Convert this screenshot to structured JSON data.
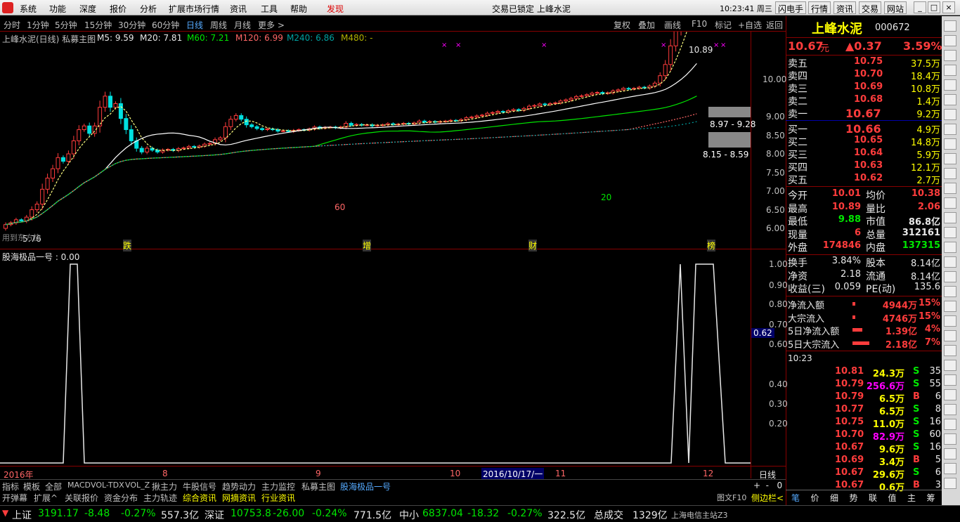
{
  "menu": {
    "items": [
      "系统",
      "功能",
      "深度",
      "报价",
      "分析",
      "扩展市场行情",
      "资讯",
      "工具",
      "帮助"
    ],
    "discover": "发现",
    "center": "交易已锁定  上峰水泥",
    "time": "10:23:41 周三",
    "buttons": [
      "闪电手",
      "行情",
      "资讯",
      "交易",
      "网站"
    ]
  },
  "period": {
    "tabs": [
      "分时",
      "1分钟",
      "5分钟",
      "15分钟",
      "30分钟",
      "60分钟",
      "日线",
      "周线",
      "月线",
      "更多 >"
    ],
    "right": [
      "复权",
      "叠加",
      "画线",
      "F10",
      "标记",
      "+自选",
      "返回"
    ]
  },
  "title": {
    "name": "上峰水泥(日线) 私募主图",
    "ma5": "M5: 9.59",
    "ma20": "M20: 7.81",
    "ma60": "M60: 7.21",
    "ma120": "M120: 6.99",
    "ma240": "M240: 6.86",
    "ma480": "M480: -"
  },
  "price_axis": [
    "10.00",
    "9.00",
    "8.50",
    "8.00",
    "7.50",
    "7.00",
    "6.50",
    "6.00"
  ],
  "annotations": {
    "high": "10.89",
    "band1": "8.97 - 9.28",
    "band2": "8.15 - 8.59",
    "low": "5.76",
    "m60": "60",
    "m20": "20",
    "cn1": "跌",
    "cn2": "增",
    "cn3": "财",
    "cn4": "榜",
    "bottomleft": "用到东方快"
  },
  "indicator": {
    "title": "股海极品一号 : 0.00",
    "axis": [
      "1.00",
      "0.90",
      "0.80",
      "0.70",
      "0.60",
      "0.40",
      "0.30",
      "0.20"
    ],
    "current": "0.62"
  },
  "dates": {
    "year": "2016年",
    "m8": "8",
    "m9": "9",
    "m10": "10",
    "cursor": "2016/10/17/一",
    "m11": "11",
    "m12": "12",
    "kind": "日线"
  },
  "tabs1": [
    "指标",
    "模板",
    "全部",
    "MACD",
    "VOL-TDX",
    "VOL_Z",
    "揪主力",
    "牛股信号",
    "趋势动力",
    "主力监控",
    "私募主图",
    "股海极品一号"
  ],
  "tabs2": [
    "开弹幕",
    "扩展^",
    "关联报价",
    "资金分布",
    "主力轨迹",
    "综合资讯",
    "网摘资讯",
    "行业资讯"
  ],
  "tabs2_right": [
    "图文F10",
    "侧边栏<"
  ],
  "stock": {
    "name": "上峰水泥",
    "code": "000672",
    "price": "10.67",
    "unit": "元",
    "change": "▲0.37",
    "pct": "3.59%"
  },
  "sell": [
    [
      "卖五",
      "10.75",
      "37.5万"
    ],
    [
      "卖四",
      "10.70",
      "18.4万"
    ],
    [
      "卖三",
      "10.69",
      "10.8万"
    ],
    [
      "卖二",
      "10.68",
      "1.4万"
    ],
    [
      "卖一",
      "10.67",
      "9.2万"
    ]
  ],
  "buy": [
    [
      "买一",
      "10.66",
      "4.9万"
    ],
    [
      "买二",
      "10.65",
      "14.8万"
    ],
    [
      "买三",
      "10.64",
      "5.9万"
    ],
    [
      "买四",
      "10.63",
      "12.1万"
    ],
    [
      "买五",
      "10.62",
      "2.7万"
    ]
  ],
  "stats": [
    [
      "今开",
      "10.01",
      "均价",
      "10.38"
    ],
    [
      "最高",
      "10.89",
      "量比",
      "2.06"
    ],
    [
      "最低",
      "9.88",
      "市值",
      "86.8亿"
    ],
    [
      "现量",
      "6",
      "总量",
      "312161"
    ],
    [
      "外盘",
      "174846",
      "内盘",
      "137315"
    ]
  ],
  "stats2": [
    [
      "换手",
      "3.84%",
      "股本",
      "8.14亿"
    ],
    [
      "净资",
      "2.18",
      "流通",
      "8.14亿"
    ],
    [
      "收益(三)",
      "0.059",
      "PE(动)",
      "135.6"
    ]
  ],
  "flows": [
    [
      "净流入额",
      "4944万",
      "15%"
    ],
    [
      "大宗流入",
      "4746万",
      "15%"
    ],
    [
      "5日净流入额",
      "1.39亿",
      "4%"
    ],
    [
      "5日大宗流入",
      "2.18亿",
      "7%"
    ]
  ],
  "ticks": {
    "time": "10:23",
    "rows": [
      [
        "10.81",
        "24.3万",
        "S",
        "35"
      ],
      [
        "10.79",
        "256.6万",
        "S",
        "55"
      ],
      [
        "10.79",
        "6.5万",
        "B",
        "6"
      ],
      [
        "10.77",
        "6.5万",
        "S",
        "8"
      ],
      [
        "10.75",
        "11.0万",
        "S",
        "16"
      ],
      [
        "10.70",
        "82.9万",
        "S",
        "60"
      ],
      [
        "10.67",
        "9.6万",
        "S",
        "16"
      ],
      [
        "10.69",
        "3.4万",
        "B",
        "5"
      ],
      [
        "10.67",
        "29.6万",
        "S",
        "6"
      ],
      [
        "10.67",
        "0.6万",
        "B",
        "3"
      ]
    ]
  },
  "rtabs": [
    "笔",
    "价",
    "细",
    "势",
    "联",
    "值",
    "主",
    "筹"
  ],
  "status": {
    "sh": "上证",
    "sh_v": "3191.17",
    "sh_c": "-8.48",
    "sh_p": "-0.27%",
    "sh_a": "557.3亿",
    "sz": "深证",
    "sz_v": "10753.8",
    "sz_c": "-26.00",
    "sz_p": "-0.24%",
    "sz_a": "771.5亿",
    "zx": "中小",
    "zx_v": "6837.04",
    "zx_c": "-18.32",
    "zx_p": "-0.27%",
    "zx_a": "322.5亿",
    "tot": "总成交",
    "tot_v": "1329亿",
    "server": "上海电信主站Z3"
  },
  "colors": {
    "up": "#ff3c3c",
    "down": "#00e0e0",
    "bg": "#000000",
    "grid": "#800000"
  }
}
